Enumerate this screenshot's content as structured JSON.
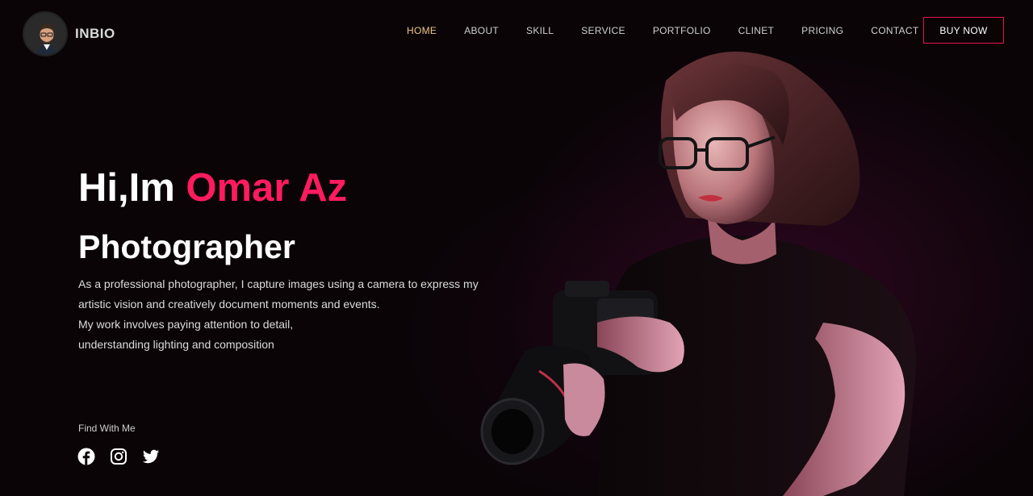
{
  "header": {
    "brand": "INBIO",
    "nav": [
      "HOME",
      "ABOUT",
      "SKILL",
      "SERVICE",
      "PORTFOLIO",
      "CLINET",
      "PRICING",
      "CONTACT"
    ],
    "active_nav": "HOME",
    "buy_label": "BUY NOW"
  },
  "hero": {
    "greeting": "Hi,Im ",
    "name": "Omar Az",
    "role": "Photographer",
    "description": [
      "As a professional photographer, I capture images using a camera to express my",
      "artistic vision and creatively document moments and events.",
      "My work involves paying attention to detail,",
      "understanding lighting and composition"
    ],
    "find_label": "Find With Me",
    "socials": [
      "facebook-icon",
      "instagram-icon",
      "twitter-icon"
    ]
  },
  "colors": {
    "background": "#0a0407",
    "accent": "#ff1b5e",
    "nav_active": "#f0c68a",
    "button_border": "#e3144c"
  }
}
